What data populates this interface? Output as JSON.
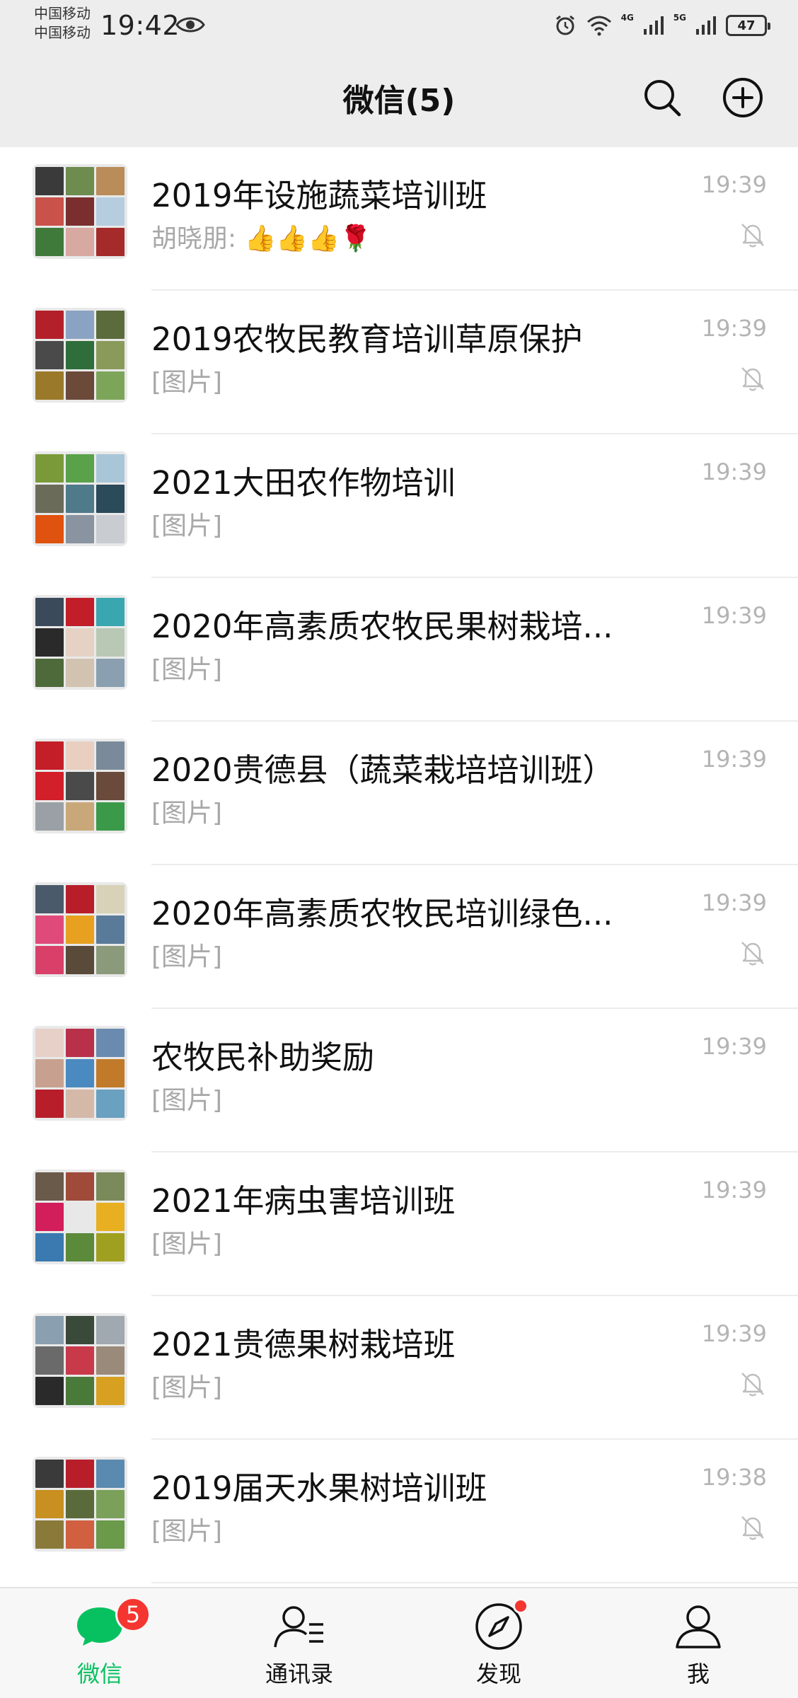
{
  "status": {
    "carrier1": "中国移动",
    "carrier2": "中国移动",
    "time": "19:42",
    "net1": "4G",
    "net2": "5G",
    "battery": "47"
  },
  "header": {
    "title": "微信(5)"
  },
  "chats": [
    {
      "name": "2019年设施蔬菜培训班",
      "preview": "胡晓朋: 👍👍👍🌹",
      "time": "19:39",
      "muted": true,
      "colors": [
        "#3a3a3a",
        "#6d8c4e",
        "#b98c5a",
        "#c9524a",
        "#7a2e2e",
        "#b6cde0",
        "#3f7a3a",
        "#d8a9a0",
        "#a52a2a"
      ]
    },
    {
      "name": "2019农牧民教育培训草原保护",
      "preview": "[图片]",
      "time": "19:39",
      "muted": true,
      "colors": [
        "#b3202a",
        "#8aa3c2",
        "#5b6b3c",
        "#4a4a4a",
        "#2f6e3a",
        "#8a9a5b",
        "#9a7a2a",
        "#6b4a3a",
        "#7da55a"
      ]
    },
    {
      "name": "2021大田农作物培训",
      "preview": "[图片]",
      "time": "19:39",
      "muted": false,
      "colors": [
        "#7a9a3a",
        "#5aa24a",
        "#a9c6d9",
        "#6b6b5a",
        "#4e7a8a",
        "#2b4a5a",
        "#e0520f",
        "#8a94a0",
        "#c9cdd2"
      ]
    },
    {
      "name": "2020年高素质农牧民果树栽培...",
      "preview": "[图片]",
      "time": "19:39",
      "muted": false,
      "colors": [
        "#3a4a5a",
        "#c21e2a",
        "#3aa6b0",
        "#2a2a2a",
        "#e6d2c4",
        "#b9c7b5",
        "#4e6a3a",
        "#d2c2b0",
        "#8aa0b0"
      ]
    },
    {
      "name": "2020贵德县（蔬菜栽培培训班）",
      "preview": "[图片]",
      "time": "19:39",
      "muted": false,
      "colors": [
        "#c41f29",
        "#e8cfc0",
        "#7a8a9a",
        "#d21f2a",
        "#4a4a4a",
        "#6a4a3a",
        "#9aa0a6",
        "#c8a878",
        "#3a9a4a"
      ]
    },
    {
      "name": "2020年高素质农牧民培训绿色...",
      "preview": "[图片]",
      "time": "19:39",
      "muted": true,
      "colors": [
        "#4a5a6a",
        "#b81e2a",
        "#d8d2b8",
        "#e04a7a",
        "#e8a020",
        "#5a7a9a",
        "#d8406a",
        "#5a4a3a",
        "#8a9a7a"
      ]
    },
    {
      "name": "农牧民补助奖励",
      "preview": "[图片]",
      "time": "19:39",
      "muted": false,
      "colors": [
        "#e6d0c8",
        "#b8304a",
        "#6a8ab0",
        "#c8a090",
        "#4a8ac0",
        "#c07a2a",
        "#b81e2a",
        "#d4b8a8",
        "#6aa0c0"
      ]
    },
    {
      "name": "2021年病虫害培训班",
      "preview": "[图片]",
      "time": "19:39",
      "muted": false,
      "colors": [
        "#6a5a4a",
        "#a04a3a",
        "#7a8a5a",
        "#d21e5a",
        "#e8e8e8",
        "#e8b020",
        "#3a7ab0",
        "#5a8a3a",
        "#a0a020"
      ]
    },
    {
      "name": "2021贵德果树栽培班",
      "preview": "[图片]",
      "time": "19:39",
      "muted": true,
      "colors": [
        "#8aa0b0",
        "#3a4a3a",
        "#a0a8b0",
        "#6a6a6a",
        "#c83a4a",
        "#9a8a7a",
        "#2a2a2a",
        "#4a7a3a",
        "#d8a020"
      ]
    },
    {
      "name": "2019届天水果树培训班",
      "preview": "[图片]",
      "time": "19:38",
      "muted": true,
      "colors": [
        "#3a3a3a",
        "#b81e2a",
        "#5a8ab0",
        "#c89020",
        "#5a6a3a",
        "#7aa05a",
        "#8a7a3a",
        "#d06040",
        "#6a9a4a"
      ]
    }
  ],
  "tabs": [
    {
      "label": "微信",
      "icon": "chat-bubble-icon",
      "badge": "5"
    },
    {
      "label": "通讯录",
      "icon": "contacts-icon"
    },
    {
      "label": "发现",
      "icon": "compass-icon"
    },
    {
      "label": "我",
      "icon": "profile-icon"
    }
  ],
  "colors": {
    "accent": "#07c160",
    "badge": "#f43530",
    "header_bg": "#ededed"
  }
}
